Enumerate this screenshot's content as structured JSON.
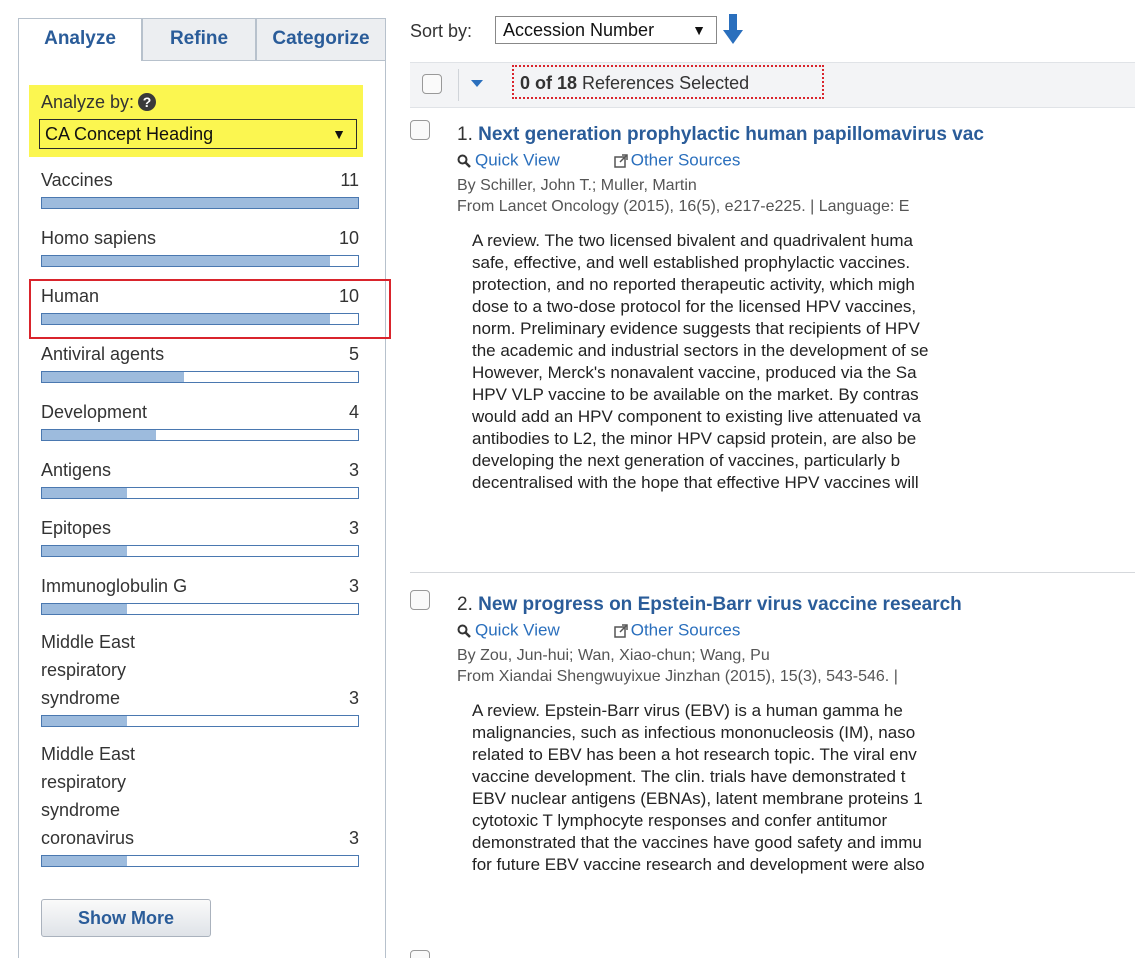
{
  "tabs": [
    {
      "label": "Analyze",
      "active": true
    },
    {
      "label": "Refine",
      "active": false
    },
    {
      "label": "Categorize",
      "active": false
    }
  ],
  "analyze": {
    "label": "Analyze by:",
    "help_icon": "question-circle-icon",
    "selected": "CA Concept Heading"
  },
  "facets": [
    {
      "label": "Vaccines",
      "count": "11",
      "fraction": 1.0
    },
    {
      "label": "Homo sapiens",
      "count": "10",
      "fraction": 0.91
    },
    {
      "label": "Human",
      "count": "10",
      "fraction": 0.91
    },
    {
      "label": "Antiviral agents",
      "count": "5",
      "fraction": 0.45
    },
    {
      "label": "Development",
      "count": "4",
      "fraction": 0.36
    },
    {
      "label": "Antigens",
      "count": "3",
      "fraction": 0.27
    },
    {
      "label": "Epitopes",
      "count": "3",
      "fraction": 0.27
    },
    {
      "label": "Immunoglobulin G",
      "count": "3",
      "fraction": 0.27
    },
    {
      "label": "Middle East respiratory syndrome",
      "count": "3",
      "fraction": 0.27
    },
    {
      "label": "Middle East respiratory syndrome coronavirus",
      "count": "3",
      "fraction": 0.27
    }
  ],
  "show_more_label": "Show More",
  "sort": {
    "label": "Sort by:",
    "selected": "Accession Number",
    "direction_icon": "arrow-down-icon"
  },
  "selection": {
    "bold": "0 of 18",
    "rest": " References Selected"
  },
  "references": [
    {
      "number": "1.",
      "title": "Next generation prophylactic human papillomavirus vac",
      "quick_view": "Quick View",
      "other_sources": "Other Sources",
      "authors": "By Schiller, John T.; Muller, Martin",
      "source": "From Lancet Oncology (2015), 16(5), e217-e225.  |  Language: E",
      "abstract": [
        "A review.  The two licensed bivalent and quadrivalent huma",
        "safe, effective, and well established prophylactic vaccines.",
        "protection, and no reported therapeutic activity, which migh",
        "dose to a two-dose protocol for the licensed HPV vaccines,",
        "norm.  Preliminary evidence suggests that recipients of HPV",
        "the academic and industrial sectors in the development of se",
        " However, Merck's nonavalent vaccine, produced via the Sa",
        "HPV VLP vaccine to be available on the market.  By contras",
        "would add an HPV component to existing live attenuated va",
        "antibodies to L2, the minor HPV capsid protein, are also be",
        "developing the next generation of vaccines, particularly b",
        "decentralised with the hope that effective HPV vaccines will"
      ]
    },
    {
      "number": "2.",
      "title": "New progress on Epstein-Barr virus vaccine research",
      "quick_view": "Quick View",
      "other_sources": "Other Sources",
      "authors": "By Zou, Jun-hui; Wan, Xiao-chun; Wang, Pu",
      "source": "From Xiandai Shengwuyixue Jinzhan (2015), 15(3), 543-546.  |",
      "abstract": [
        "A review.  Epstein-Barr virus (EBV) is a human gamma he",
        "malignancies, such as infectious mononucleosis (IM), naso",
        "related to EBV has been a hot research topic.  The viral env",
        "vaccine development.  The clin. trials have demonstrated t",
        " EBV nuclear antigens (EBNAs), latent membrane proteins 1",
        "cytotoxic T lymphocyte responses and confer antitumor",
        "demonstrated that the vaccines have good safety and immu",
        "for future EBV vaccine research and development were also"
      ]
    }
  ],
  "colors": {
    "link": "#2a5c99",
    "highlight_yellow": "#fbf650",
    "highlight_red": "#d9242c",
    "bar_fill": "#9dbbdd"
  }
}
